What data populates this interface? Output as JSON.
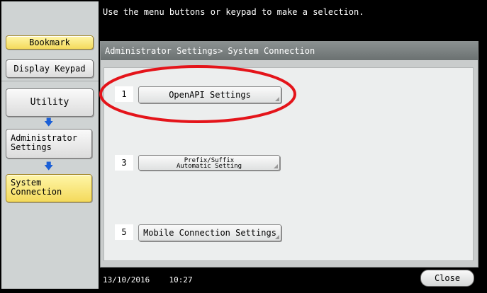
{
  "header": {
    "message": "Use the menu buttons or keypad to make a selection."
  },
  "sidebar": {
    "bookmark_label": "Bookmark",
    "display_keypad_label": "Display Keypad",
    "breadcrumb": [
      {
        "label": "Utility"
      },
      {
        "label_line1": "Administrator",
        "label_line2": "Settings"
      },
      {
        "label_line1": "System",
        "label_line2": "Connection"
      }
    ]
  },
  "panel": {
    "title": "Administrator Settings> System Connection",
    "items": [
      {
        "number": "1",
        "label": "OpenAPI Settings"
      },
      {
        "number": "3",
        "label_line1": "Prefix/Suffix",
        "label_line2": "Automatic Setting"
      },
      {
        "number": "5",
        "label": "Mobile Connection Settings"
      }
    ]
  },
  "status": {
    "date": "13/10/2016",
    "time": "10:27",
    "close_label": "Close"
  },
  "colors": {
    "highlight": "#e4141a",
    "yellow_button": "#f4da5c",
    "arrow": "#1b5fd6"
  }
}
